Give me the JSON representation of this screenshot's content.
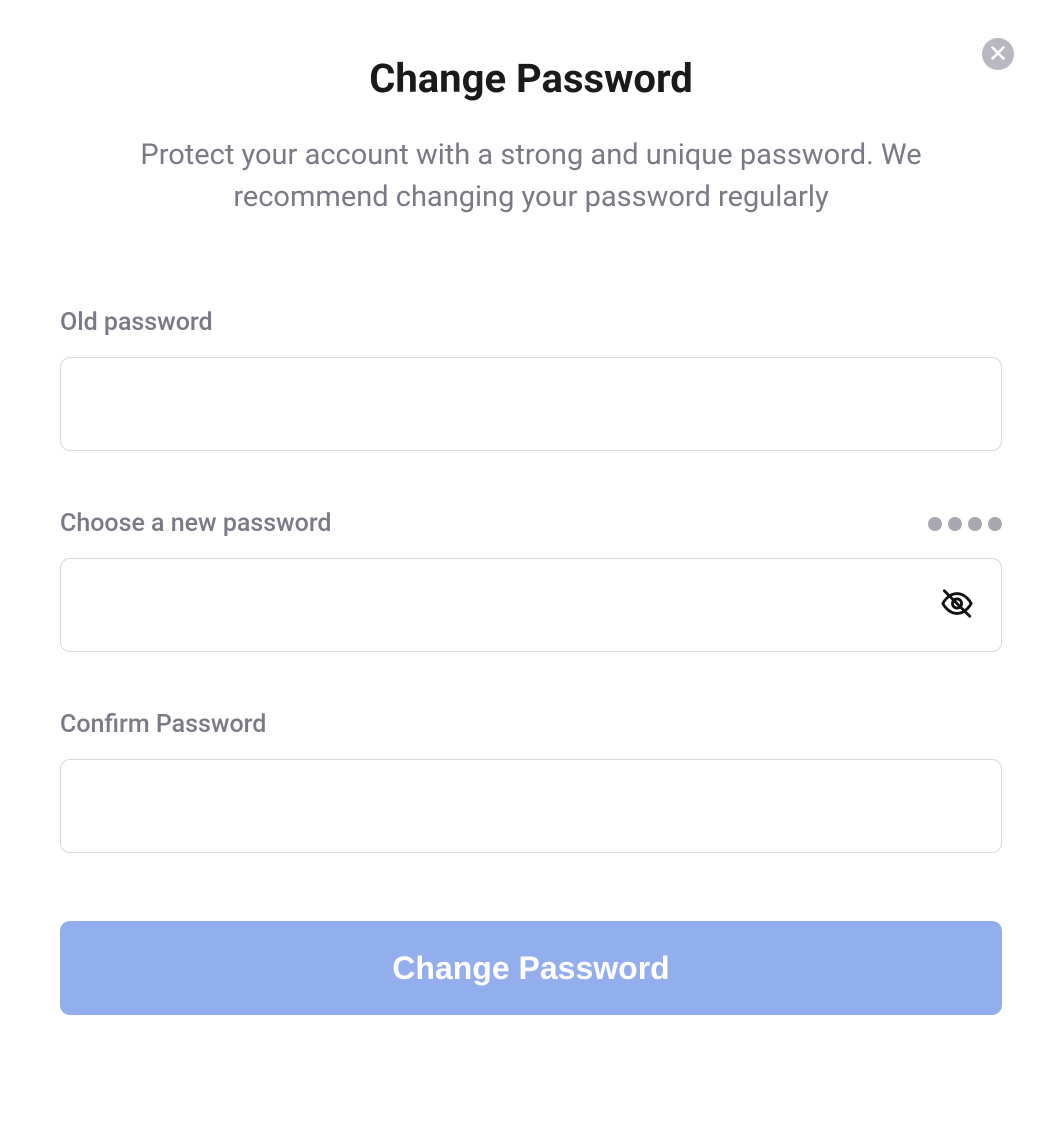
{
  "header": {
    "title": "Change Password",
    "subtitle": "Protect your account with a strong and unique password. We recommend changing your password regularly"
  },
  "fields": {
    "old_password": {
      "label": "Old password",
      "value": ""
    },
    "new_password": {
      "label": "Choose a new password",
      "value": "",
      "strength_dots": 4
    },
    "confirm_password": {
      "label": "Confirm Password",
      "value": ""
    }
  },
  "actions": {
    "submit_label": "Change Password"
  },
  "colors": {
    "accent": "#93aeec",
    "muted_text": "#7a7986",
    "border": "#d8d8df"
  }
}
